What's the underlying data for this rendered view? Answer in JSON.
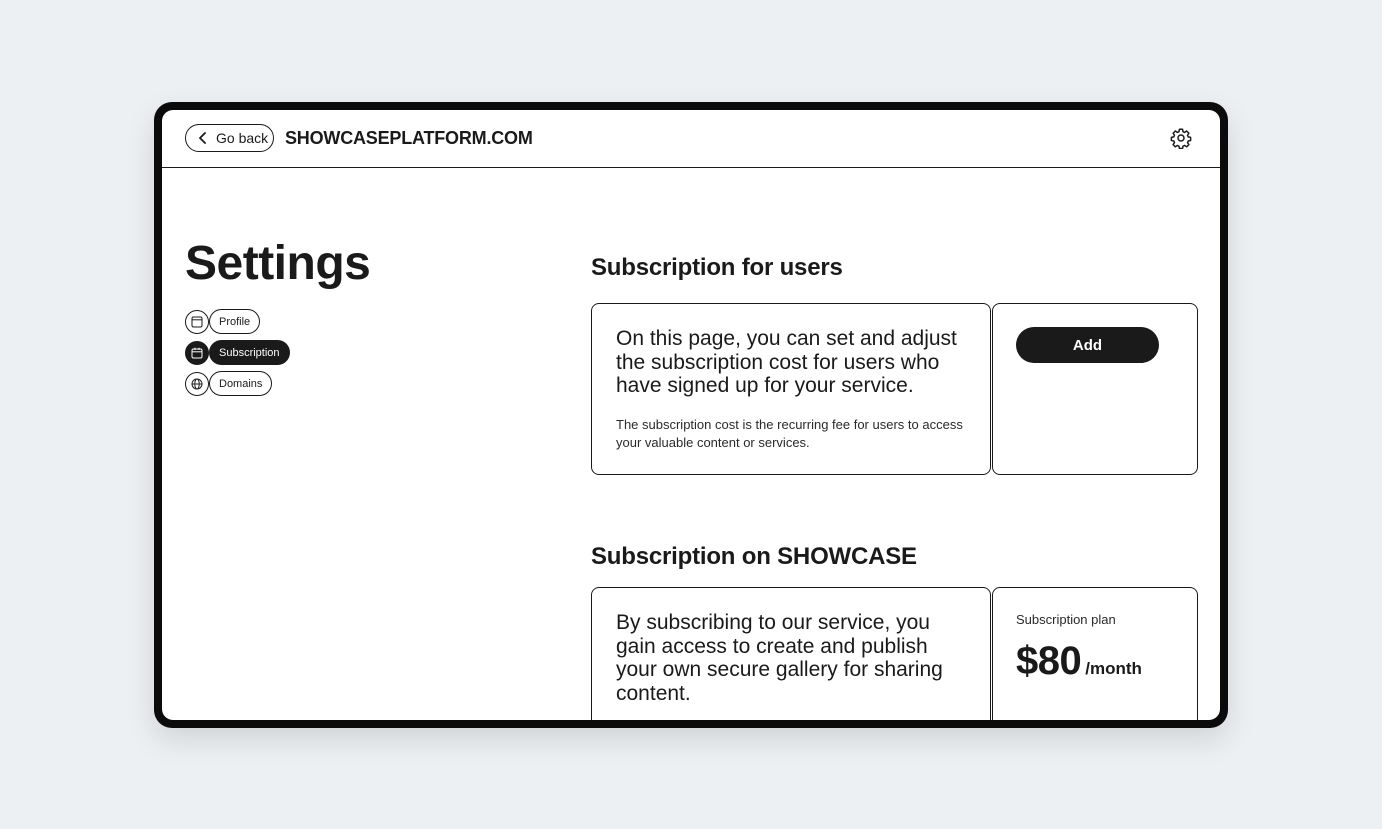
{
  "header": {
    "back_label": "Go back",
    "site_title": "SHOWCASEPLATFORM.COM"
  },
  "sidebar": {
    "title": "Settings",
    "items": [
      {
        "label": "Profile",
        "icon": "window-icon",
        "active": false
      },
      {
        "label": "Subscription",
        "icon": "calendar-icon",
        "active": true
      },
      {
        "label": "Domains",
        "icon": "globe-icon",
        "active": false
      }
    ]
  },
  "users_section": {
    "title": "Subscription for users",
    "lead": "On this page, you can set and adjust the subscription cost for users who have signed up for your service.",
    "description": "The subscription cost is the recurring fee for users to access your valuable content or services.",
    "add_label": "Add"
  },
  "showcase_section": {
    "title": "Subscription on SHOWCASE",
    "lead": "By subscribing to our service, you gain access to create and publish your own secure gallery for sharing content.",
    "plan_label": "Subscription plan",
    "price": "$80",
    "period": "/month"
  },
  "colors": {
    "background": "#edf0f3",
    "device": "#0b0b0b",
    "primary": "#1a1a1a"
  }
}
